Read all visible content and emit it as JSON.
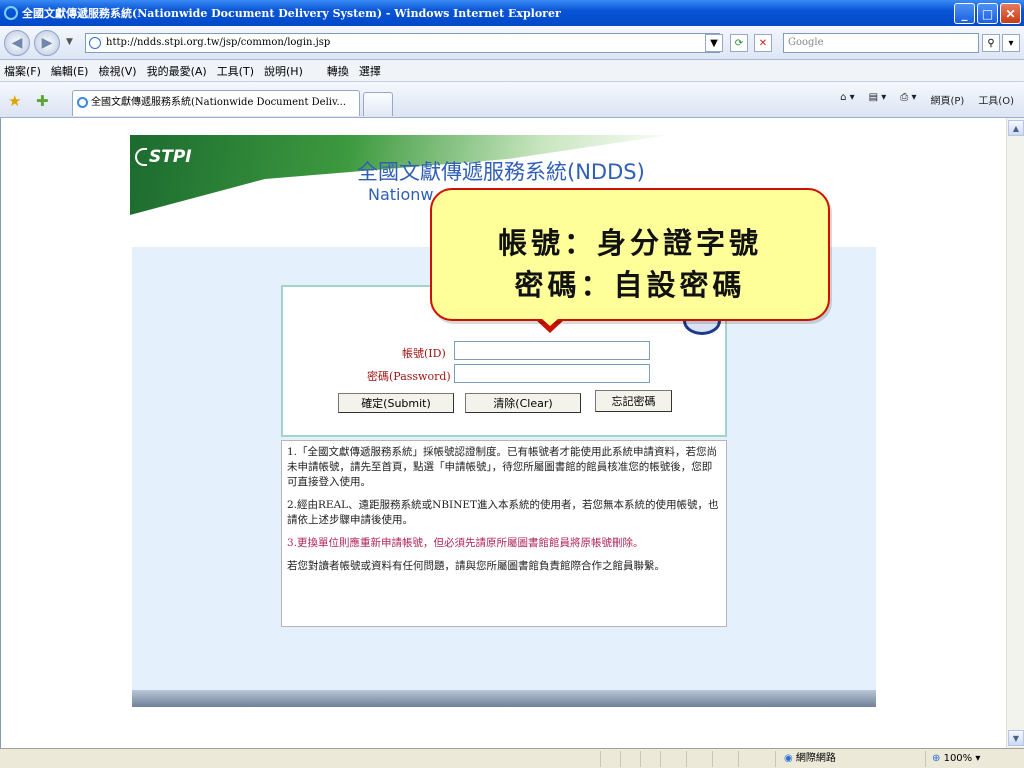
{
  "window": {
    "title": "全國文獻傳遞服務系統(Nationwide Document Delivery System) - Windows Internet Explorer"
  },
  "address": {
    "url": "http://ndds.stpi.org.tw/jsp/common/login.jsp",
    "search_placeholder": "Google"
  },
  "menu": [
    "檔案(F)",
    "編輯(E)",
    "檢視(V)",
    "我的最愛(A)",
    "工具(T)",
    "說明(H)",
    "轉換",
    "選擇"
  ],
  "tab": {
    "label": "全國文獻傳遞服務系統(Nationwide Document Deliv..."
  },
  "command_bar": [
    "網頁(P)",
    "工具(O)"
  ],
  "page": {
    "logo": "STPI",
    "system_name": "全國文獻傳遞服務系統(NDDS)",
    "system_name_en_partial": "Nationw",
    "login": {
      "id_label": "帳號(ID)",
      "password_label": "密碼(Password)",
      "submit": "確定(Submit)",
      "clear": "清除(Clear)",
      "forgot": "忘記密碼"
    },
    "notices": [
      "1.「全國文獻傳遞服務系統」採帳號認證制度。已有帳號者才能使用此系統申請資料，若您尚未申請帳號，請先至首頁，點選「申請帳號」，待您所屬圖書館的館員核准您的帳號後，您即可直接登入使用。",
      "2.經由REAL、遠距服務系統或NBINET進入本系統的使用者，若您無本系統的使用帳號，也請依上述步驟申請後使用。",
      "3.更換單位則應重新申請帳號，但必須先請原所屬圖書館館員將原帳號刪除。",
      "若您對讀者帳號或資料有任何問題，請與您所屬圖書館負責館際合作之館員聯繫。"
    ]
  },
  "callout": {
    "line1": "帳號：身分證字號",
    "line2": "密碼：自設密碼"
  },
  "status": {
    "zone": "網際網路",
    "zoom": "100%"
  },
  "colors": {
    "title_blue": "#0a55d6",
    "panel_bg": "#e4f1fd",
    "callout_bg": "#ffff99",
    "callout_border": "#cc1100",
    "label_red": "#a01616"
  }
}
